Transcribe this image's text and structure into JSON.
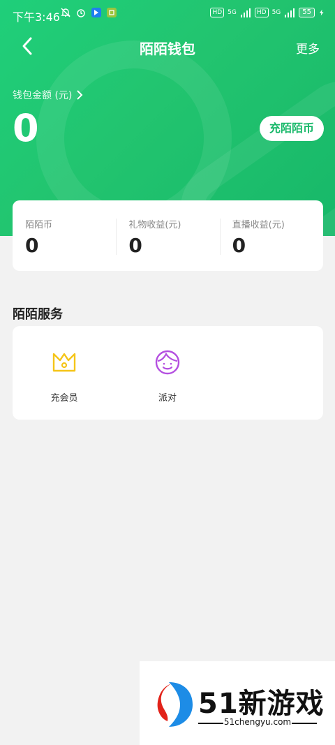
{
  "status_bar": {
    "time": "下午3:46",
    "net1": "5G",
    "net2": "5G",
    "hd": "HD",
    "battery": "55"
  },
  "nav": {
    "title": "陌陌钱包",
    "more": "更多"
  },
  "wallet": {
    "balance_label": "钱包金额 (元)",
    "balance_value": "0",
    "recharge_button": "充陌陌币"
  },
  "stats": [
    {
      "label": "陌陌币",
      "value": "0"
    },
    {
      "label": "礼物收益(元)",
      "value": "0"
    },
    {
      "label": "直播收益(元)",
      "value": "0"
    }
  ],
  "services": {
    "title": "陌陌服务",
    "items": [
      {
        "label": "充会员",
        "icon": "crown-icon",
        "color": "#f5c518"
      },
      {
        "label": "派对",
        "icon": "smiling-girl-icon",
        "color": "#b44fe0"
      }
    ]
  },
  "watermark": {
    "brand": "51新游戏",
    "url": "51chengyu.com"
  },
  "colors": {
    "accent": "#1fc872",
    "background": "#f2f2f2"
  }
}
